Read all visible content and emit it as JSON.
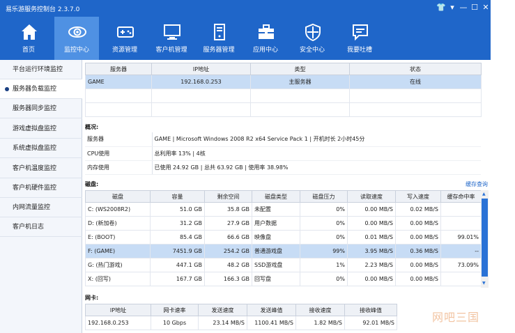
{
  "app": {
    "title": "易乐游服务控制台 2.3.7.0",
    "controls": {
      "shirt": "👕",
      "menu": "▾",
      "minimize": "—",
      "maximize": "☐",
      "close": "✕"
    }
  },
  "toolbar": [
    {
      "label": "首页",
      "icon": "home-icon"
    },
    {
      "label": "监控中心",
      "icon": "eye-icon"
    },
    {
      "label": "资源管理",
      "icon": "gamepad-icon"
    },
    {
      "label": "客户机管理",
      "icon": "monitor-icon"
    },
    {
      "label": "服务器管理",
      "icon": "server-icon"
    },
    {
      "label": "应用中心",
      "icon": "toolbox-icon"
    },
    {
      "label": "安全中心",
      "icon": "shield-icon"
    },
    {
      "label": "我要吐槽",
      "icon": "chat-icon"
    }
  ],
  "sidebar": [
    {
      "label": "平台运行环境监控"
    },
    {
      "label": "服务器负载监控"
    },
    {
      "label": "服务器同步监控"
    },
    {
      "label": "游戏虚拟盘监控"
    },
    {
      "label": "系统虚拟盘监控"
    },
    {
      "label": "客户机温度监控"
    },
    {
      "label": "客户机硬件监控"
    },
    {
      "label": "内网流量监控"
    },
    {
      "label": "客户机日志"
    }
  ],
  "servers": {
    "columns": [
      "服务器",
      "IP地址",
      "类型",
      "状态"
    ],
    "rows": [
      {
        "name": "GAME",
        "ip": "192.168.0.253",
        "type": "主服务器",
        "status": "在线"
      }
    ]
  },
  "overview": {
    "title": "概况:",
    "rows": [
      {
        "key": "服务器",
        "value": "GAME | Microsoft Windows 2008 R2 x64 Service Pack 1 | 开机时长 2小时45分"
      },
      {
        "key": "CPU使用",
        "value": "总利用率 13% | 4核"
      },
      {
        "key": "内存使用",
        "value": "已使用 24.92 GB | 总共 63.92 GB | 使用率 38.98%"
      }
    ]
  },
  "disk": {
    "title": "磁盘:",
    "link": "缓存查询",
    "columns": [
      "磁盘",
      "容量",
      "剩余空间",
      "磁盘类型",
      "磁盘压力",
      "读取速度",
      "写入速度",
      "缓存命中率"
    ],
    "rows": [
      {
        "disk": "C: (WS2008R2)",
        "capacity": "51.0 GB",
        "free": "35.8 GB",
        "type": "未配置",
        "pressure": "0%",
        "read": "0.00 MB/S",
        "write": "0.02 MB/S",
        "hit": ""
      },
      {
        "disk": "D: (新加卷)",
        "capacity": "31.2 GB",
        "free": "27.9 GB",
        "type": "用户数据",
        "pressure": "0%",
        "read": "0.00 MB/S",
        "write": "0.00 MB/S",
        "hit": ""
      },
      {
        "disk": "E: (BOOT)",
        "capacity": "85.4 GB",
        "free": "66.6 GB",
        "type": "映像盘",
        "pressure": "0%",
        "read": "0.01 MB/S",
        "write": "0.00 MB/S",
        "hit": "99.01%"
      },
      {
        "disk": "F: (GAME)",
        "capacity": "7451.9 GB",
        "free": "254.2 GB",
        "type": "普通游戏盘",
        "pressure": "99%",
        "read": "3.95 MB/S",
        "write": "0.36 MB/S",
        "hit": "--"
      },
      {
        "disk": "G: (热门游戏)",
        "capacity": "447.1 GB",
        "free": "48.2 GB",
        "type": "SSD游戏盘",
        "pressure": "1%",
        "read": "2.23 MB/S",
        "write": "0.00 MB/S",
        "hit": "73.09%"
      },
      {
        "disk": "X: (回写)",
        "capacity": "167.7 GB",
        "free": "166.3 GB",
        "type": "回写盘",
        "pressure": "0%",
        "read": "0.00 MB/S",
        "write": "0.00 MB/S",
        "hit": ""
      }
    ]
  },
  "nic": {
    "title": "网卡:",
    "columns": [
      "IP地址",
      "网卡速率",
      "发送速度",
      "发送峰值",
      "接收速度",
      "接收峰值"
    ],
    "rows": [
      {
        "ip": "192.168.0.253",
        "rate": "10 Gbps",
        "send": "23.14 MB/S",
        "send_peak": "1100.41 MB/S",
        "recv": "1.82 MB/S",
        "recv_peak": "92.01 MB/S"
      }
    ]
  },
  "watermark": "网吧三国",
  "colors": {
    "brand": "#1f66c9",
    "active_tab": "#4f91e3",
    "selected_row": "#c7dcf5",
    "link": "#1f66c9"
  }
}
